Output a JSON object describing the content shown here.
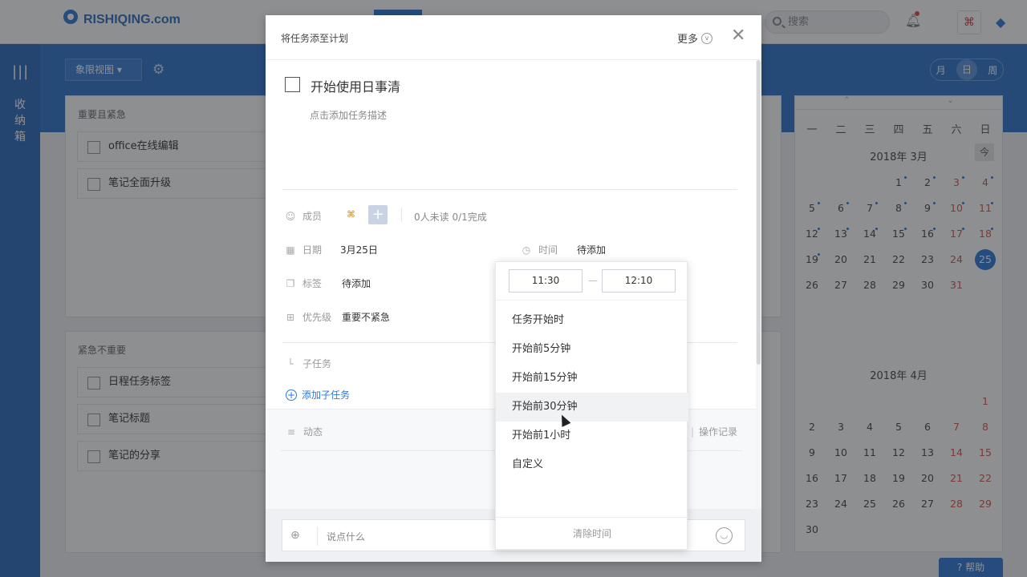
{
  "app": {
    "logo_text": "RISHIQING.com",
    "search_placeholder": "搜索",
    "left_rail_label": "收纳箱",
    "view_button": "象限视图",
    "view_toggle": [
      "月",
      "日",
      "周"
    ],
    "help": "帮助"
  },
  "quadrants": [
    {
      "title": "重要且紧急",
      "items": [
        "office在线编辑",
        "笔记全面升级"
      ]
    },
    {
      "title": "紧急不重要",
      "items": [
        "日程任务标签",
        "笔记标题",
        "笔记的分享"
      ]
    }
  ],
  "calendar": {
    "weekdays": [
      "一",
      "二",
      "三",
      "四",
      "五",
      "六",
      "日"
    ],
    "today_label": "今",
    "months": [
      {
        "title": "2018年 3月",
        "lead_blanks": 3,
        "days": [
          "1",
          "2",
          "3",
          "4",
          "5",
          "6",
          "7",
          "8",
          "9",
          "10",
          "11",
          "12",
          "13",
          "14",
          "15",
          "16",
          "17",
          "18",
          "19",
          "20",
          "21",
          "22",
          "23",
          "24",
          "25",
          "26",
          "27",
          "28",
          "29",
          "30",
          "31"
        ],
        "selected": "25"
      },
      {
        "title": "2018年 4月",
        "lead_blanks": 6,
        "days": [
          "1",
          "2",
          "3",
          "4",
          "5",
          "6",
          "7",
          "8",
          "9",
          "10",
          "11",
          "12",
          "13",
          "14",
          "15",
          "16",
          "17",
          "18",
          "19",
          "20",
          "21",
          "22",
          "23",
          "24",
          "25",
          "26",
          "27",
          "28",
          "29",
          "30"
        ]
      }
    ]
  },
  "modal": {
    "title": "将任务添至计划",
    "more_label": "更多",
    "task_title": "开始使用日事清",
    "task_desc_placeholder": "点击添加任务描述",
    "members_label": "成员",
    "members_stat": "0人未读  0/1完成",
    "date_label": "日期",
    "date_value": "3月25日",
    "time_label": "时间",
    "time_value": "待添加",
    "tag_label": "标签",
    "tag_value": "待添加",
    "priority_label": "优先级",
    "priority_value": "重要不紧急",
    "subtask_label": "子任务",
    "add_subtask": "添加子任务",
    "activity_label": "动态",
    "log_label": "操作记录",
    "comment_placeholder": "说点什么"
  },
  "time_dropdown": {
    "start": "11:30",
    "end": "12:10",
    "separator": "—",
    "options": [
      "任务开始时",
      "开始前5分钟",
      "开始前15分钟",
      "开始前30分钟",
      "开始前1小时",
      "自定义"
    ],
    "hover_index": 3,
    "clear": "清除时间"
  }
}
